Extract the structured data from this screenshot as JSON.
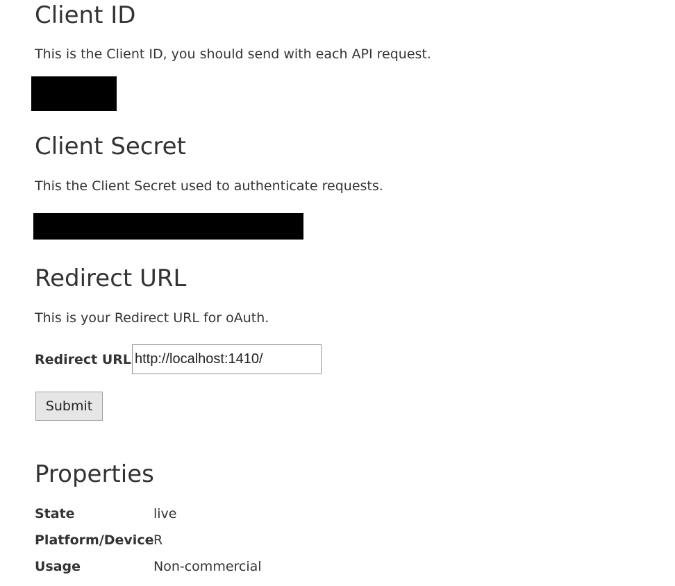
{
  "client_id": {
    "title": "Client ID",
    "description": "This is the Client ID, you should send with each API request."
  },
  "client_secret": {
    "title": "Client Secret",
    "description": "This the Client Secret used to authenticate requests."
  },
  "redirect": {
    "title": "Redirect URL",
    "description": "This is your Redirect URL for oAuth.",
    "field_label": "Redirect URL",
    "field_value": "http://localhost:1410/",
    "submit_label": "Submit"
  },
  "properties": {
    "title": "Properties",
    "rows": [
      {
        "label": "State",
        "value": "live"
      },
      {
        "label": "Platform/Device",
        "value": "R"
      },
      {
        "label": "Usage",
        "value": "Non-commercial"
      }
    ]
  }
}
